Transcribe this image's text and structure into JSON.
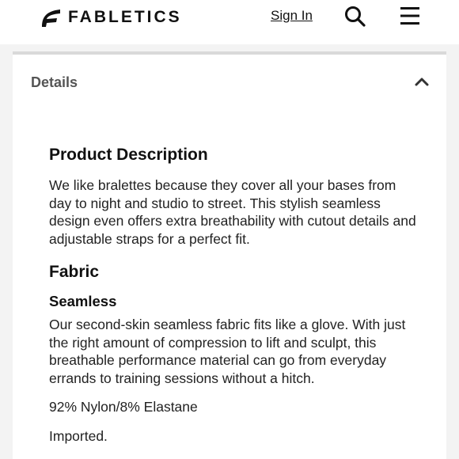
{
  "header": {
    "brand": "FABLETICS",
    "sign_in_label": "Sign In"
  },
  "accordion": {
    "title": "Details",
    "state": "expanded"
  },
  "product_description": {
    "heading": "Product Description",
    "text": "We like bralettes because they cover all your bases from day to night and studio to street. This stylish seamless design even offers extra breathability with cutout details and adjustable straps for a perfect fit."
  },
  "fabric": {
    "heading": "Fabric",
    "type_heading": "Seamless",
    "text": "Our second-skin seamless fabric fits like a glove. With just the right amount of compression to lift and sculpt, this breathable performance material can go from everyday errands to training sessions without a hitch.",
    "composition": "92% Nylon/8% Elastane",
    "origin": "Imported."
  },
  "icons": {
    "logo": "fabletics-logo-icon",
    "search": "search-icon",
    "menu": "menu-icon",
    "collapse": "chevron-up-icon"
  },
  "colors": {
    "text": "#111111",
    "muted_label": "#555555",
    "frame": "#f3f3f3",
    "divider": "#d9d9d9"
  }
}
